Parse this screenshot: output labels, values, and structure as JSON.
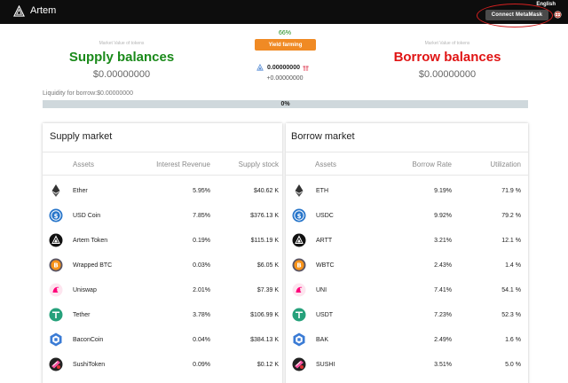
{
  "app": {
    "brand": "Artem",
    "language": "English",
    "connect_label": "Connect MetaMask"
  },
  "balances": {
    "supply": {
      "label": "Market Value of tokens",
      "title": "Supply balances",
      "value": "$0.00000000"
    },
    "borrow": {
      "label": "Market Value of tokens",
      "title": "Borrow balances",
      "value": "$0.00000000"
    },
    "yield_pct": "66%",
    "yield_label": "Yield farming",
    "token_amount": "0.00000000",
    "token_change": "+0.00000000"
  },
  "liquidity": {
    "label": "Liquidity for borrow:$0.00000000",
    "progress_text": "0%",
    "progress_fraction": 0
  },
  "supply_market": {
    "title": "Supply market",
    "headers": [
      "Assets",
      "Interest Revenue",
      "Supply stock"
    ],
    "rows": [
      {
        "icon": "ether-icon",
        "name": "Ether",
        "rate": "5.95%",
        "stock": "$40.62 K"
      },
      {
        "icon": "usd-coin-icon",
        "name": "USD Coin",
        "rate": "7.85%",
        "stock": "$376.13 K"
      },
      {
        "icon": "artem-token-icon",
        "name": "Artem Token",
        "rate": "0.19%",
        "stock": "$115.19 K"
      },
      {
        "icon": "wrapped-btc-icon",
        "name": "Wrapped BTC",
        "rate": "0.03%",
        "stock": "$6.05 K"
      },
      {
        "icon": "uniswap-icon",
        "name": "Uniswap",
        "rate": "2.01%",
        "stock": "$7.39 K"
      },
      {
        "icon": "tether-icon",
        "name": "Tether",
        "rate": "3.78%",
        "stock": "$106.99 K"
      },
      {
        "icon": "baconcoin-icon",
        "name": "BaconCoin",
        "rate": "0.04%",
        "stock": "$384.13 K"
      },
      {
        "icon": "sushitoken-icon",
        "name": "SushiToken",
        "rate": "0.09%",
        "stock": "$0.12 K"
      }
    ]
  },
  "borrow_market": {
    "title": "Borrow market",
    "headers": [
      "Assets",
      "Borrow Rate",
      "Utilization"
    ],
    "rows": [
      {
        "icon": "ether-icon",
        "name": "ETH",
        "rate": "9.19%",
        "util": "71.9 %"
      },
      {
        "icon": "usd-coin-icon",
        "name": "USDC",
        "rate": "9.92%",
        "util": "79.2 %"
      },
      {
        "icon": "artem-token-icon",
        "name": "ARTT",
        "rate": "3.21%",
        "util": "12.1 %"
      },
      {
        "icon": "wrapped-btc-icon",
        "name": "WBTC",
        "rate": "2.43%",
        "util": "1.4 %"
      },
      {
        "icon": "uniswap-icon",
        "name": "UNI",
        "rate": "7.41%",
        "util": "54.1 %"
      },
      {
        "icon": "tether-icon",
        "name": "USDT",
        "rate": "7.23%",
        "util": "52.3 %"
      },
      {
        "icon": "baconcoin-icon",
        "name": "BAK",
        "rate": "2.49%",
        "util": "1.6 %"
      },
      {
        "icon": "sushitoken-icon",
        "name": "SUSHI",
        "rate": "3.51%",
        "util": "5.0 %"
      }
    ]
  },
  "colors": {
    "supply_green": "#1a8a1a",
    "borrow_red": "#e01414",
    "yield_orange": "#f08a24",
    "topbar": "#0d0d0d"
  }
}
